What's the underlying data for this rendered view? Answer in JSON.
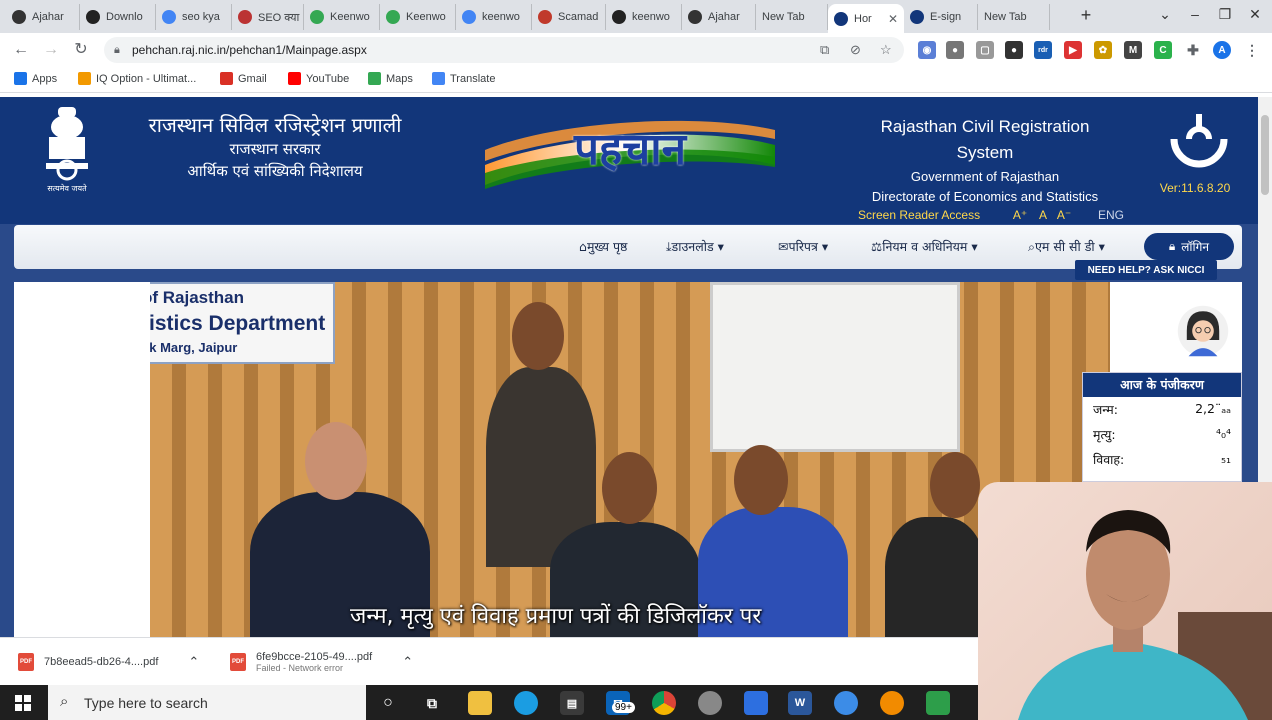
{
  "browser": {
    "tabs": [
      {
        "label": "Ajahar",
        "color": "#333"
      },
      {
        "label": "Downlo",
        "color": "#222"
      },
      {
        "label": "seo kya",
        "color": "#4285f4"
      },
      {
        "label": "SEO क्या",
        "color": "#b33"
      },
      {
        "label": "Keenwo",
        "color": "#34a853"
      },
      {
        "label": "Keenwo",
        "color": "#34a853"
      },
      {
        "label": "keenwo",
        "color": "#4285f4"
      },
      {
        "label": "Scamad",
        "color": "#c0392b"
      },
      {
        "label": "keenwo",
        "color": "#222"
      },
      {
        "label": "Ajahar",
        "color": "#333"
      },
      {
        "label": "New Tab",
        "color": ""
      },
      {
        "label": "Hor",
        "color": "#12367a",
        "active": true
      },
      {
        "label": "E-sign",
        "color": "#12367a"
      },
      {
        "label": "New Tab",
        "color": ""
      }
    ],
    "new_tab": "+",
    "url": "pehchan.raj.nic.in/pehchan1/Mainpage.aspx",
    "bookmarks": [
      {
        "label": "Apps",
        "color": "#1a73e8"
      },
      {
        "label": "IQ Option - Ultimat...",
        "color": "#f29900"
      },
      {
        "label": "Gmail",
        "color": "#d93025"
      },
      {
        "label": "YouTube",
        "color": "#ff0000"
      },
      {
        "label": "Maps",
        "color": "#34a853"
      },
      {
        "label": "Translate",
        "color": "#4285f4"
      }
    ],
    "profile_initial": "A"
  },
  "site": {
    "hi_title": "राजस्थान सिविल रजिस्ट्रेशन प्रणाली",
    "hi_sub1": "राजस्थान सरकार",
    "hi_sub2": "आर्थिक एवं सांख्यिकी निदेशालय",
    "emblem_motto": "सत्यमेव जयते",
    "brand": "पहचान",
    "en_title_1": "Rajasthan Civil Registration",
    "en_title_2": "System",
    "en_sub1": "Government of Rajasthan",
    "en_sub2": "Directorate of Economics and Statistics",
    "screen_reader": "Screen Reader Access",
    "font_controls": [
      "A⁺",
      "A",
      "A⁻"
    ],
    "lang": "ENG",
    "version": "Ver:11.6.8.20",
    "nav": [
      {
        "label": "मुख्य पृष्ठ",
        "icon": "home-icon"
      },
      {
        "label": "डाउनलोड ▾",
        "icon": "download-icon"
      },
      {
        "label": "परिपत्र ▾",
        "icon": "circular-icon"
      },
      {
        "label": "नियम व अधिनियम ▾",
        "icon": "gavel-icon"
      },
      {
        "label": "एम सी सी डी ▾",
        "icon": "search-icon"
      }
    ],
    "login": "लॉगिन",
    "need_help": "NEED HELP? ASK NICCI",
    "photo_sign_1": "of Rajasthan",
    "photo_sign_2": "tistics Department",
    "photo_sign_3": "ak Marg, Jaipur",
    "caption": "जन्म, मृत्यु एवं विवाह प्रमाण पत्रों की डिजिलॉकर पर",
    "today_reg": {
      "heading": "आज के पंजीकरण",
      "rows": [
        {
          "label": "जन्म:",
          "value": "2,2¨ₐₐ"
        },
        {
          "label": "मृत्यु:",
          "value": "⁴₀⁴"
        },
        {
          "label": "विवाह:",
          "value": "₅₁"
        }
      ]
    }
  },
  "downloads": [
    {
      "name": "7b8eead5-db26-4....pdf",
      "status": ""
    },
    {
      "name": "6fe9bcce-2105-49....pdf",
      "status": "Failed - Network error"
    }
  ],
  "taskbar": {
    "search_placeholder": "Type here to search",
    "mail_badge": "99+"
  }
}
